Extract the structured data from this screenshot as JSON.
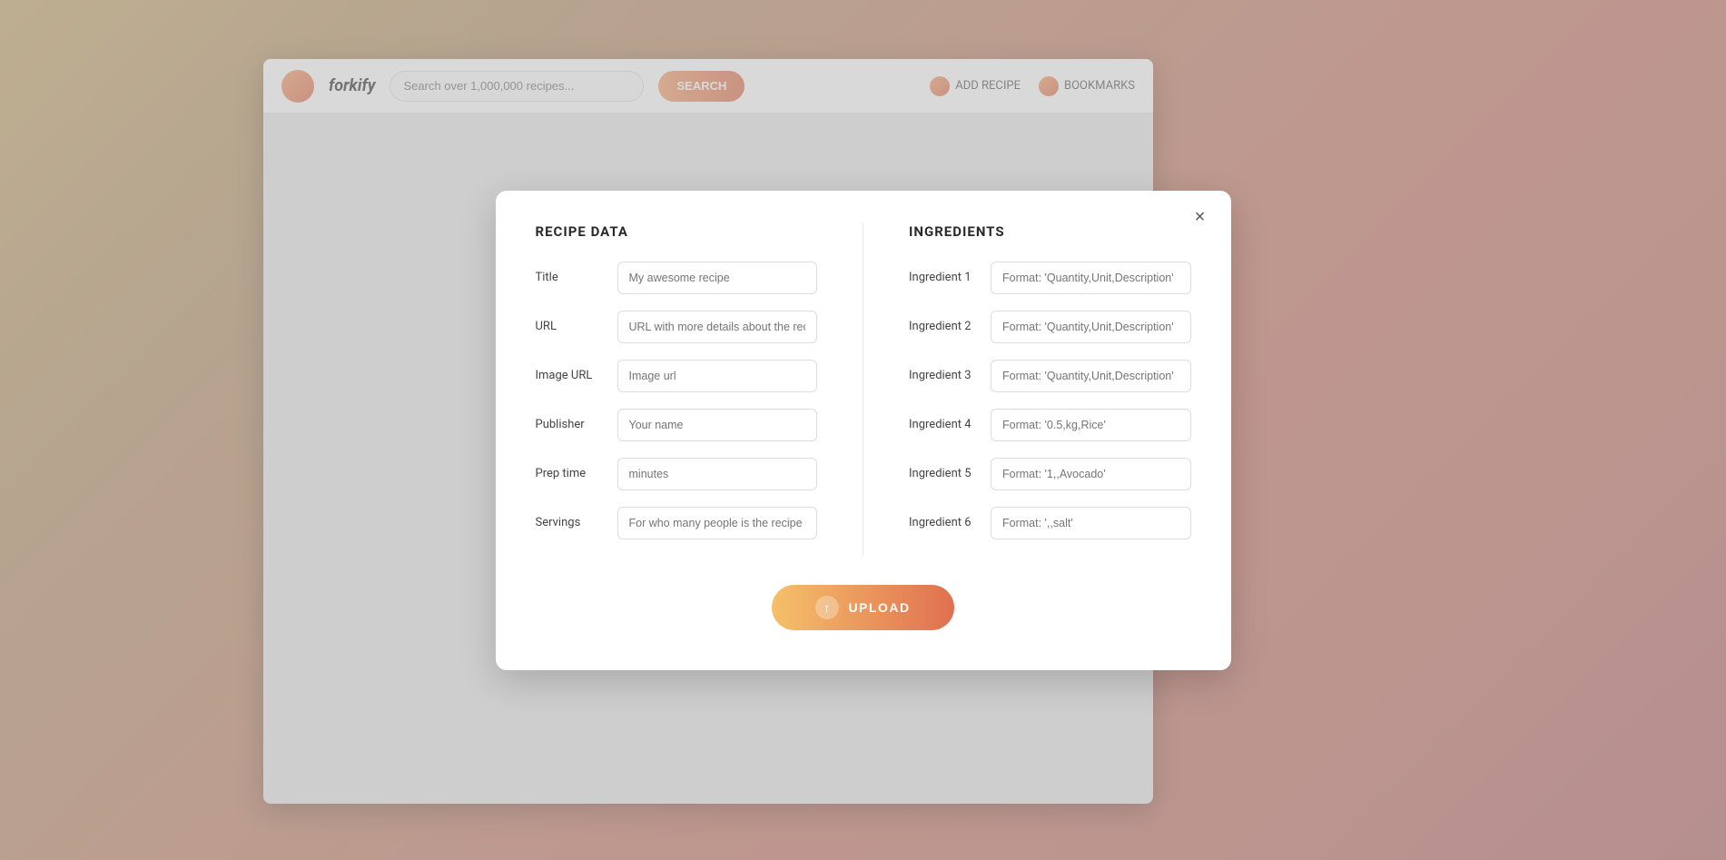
{
  "background": {
    "colors": [
      "#c9a96e",
      "#b8956a",
      "#c4876a",
      "#c97a6a",
      "#b86a6a"
    ]
  },
  "header": {
    "logo_text": "forkify",
    "search_placeholder": "Search over 1,000,000 recipes...",
    "search_button_label": "SEARCH",
    "action1_label": "ADD RECIPE",
    "action2_label": "BOOKMARKS"
  },
  "modal": {
    "close_label": "×",
    "recipe_section_title": "RECIPE DATA",
    "ingredients_section_title": "INGREDIENTS",
    "fields": {
      "title_label": "Title",
      "title_placeholder": "My awesome recipe",
      "url_label": "URL",
      "url_placeholder": "URL with more details about the recipe",
      "image_url_label": "Image URL",
      "image_url_placeholder": "Image url",
      "publisher_label": "Publisher",
      "publisher_placeholder": "Your name",
      "prep_time_label": "Prep time",
      "prep_time_placeholder": "minutes",
      "servings_label": "Servings",
      "servings_placeholder": "For who many people is the recipe"
    },
    "ingredients": [
      {
        "label": "Ingredient 1",
        "placeholder": "Format: 'Quantity,Unit,Description'"
      },
      {
        "label": "Ingredient 2",
        "placeholder": "Format: 'Quantity,Unit,Description'"
      },
      {
        "label": "Ingredient 3",
        "placeholder": "Format: 'Quantity,Unit,Description'"
      },
      {
        "label": "Ingredient 4",
        "placeholder": "Format: '0.5,kg,Rice'"
      },
      {
        "label": "Ingredient 5",
        "placeholder": "Format: '1,,Avocado'"
      },
      {
        "label": "Ingredient 6",
        "placeholder": "Format: ',,salt'"
      }
    ],
    "upload_button_label": "UPLOAD",
    "upload_icon": "↑"
  }
}
